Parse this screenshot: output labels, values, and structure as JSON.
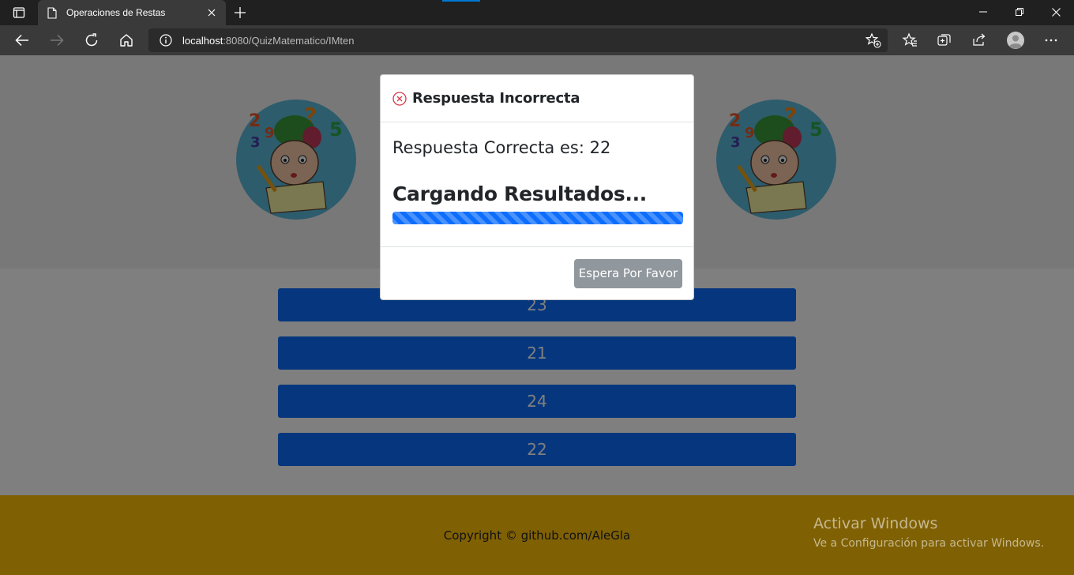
{
  "browser": {
    "tab_title": "Operaciones de Restas",
    "url_host": "localhost",
    "url_path": ":8080/QuizMatematico/IMten"
  },
  "colors": {
    "primary": "#0d6efd",
    "footer": "#ffc107",
    "secondary": "#6c757d",
    "error": "#dc3545"
  },
  "answers": [
    "23",
    "21",
    "24",
    "22"
  ],
  "footer": {
    "copyright": "Copyright © github.com/AleGla"
  },
  "modal": {
    "title": "Respuesta Incorrecta",
    "answer_text": "Respuesta Correcta es: 22",
    "loading_text": "Cargando Resultados...",
    "progress": 1.0,
    "wait_button": "Espera Por Favor"
  },
  "watermark": {
    "title": "Activar Windows",
    "subtitle": "Ve a Configuración para activar Windows."
  }
}
